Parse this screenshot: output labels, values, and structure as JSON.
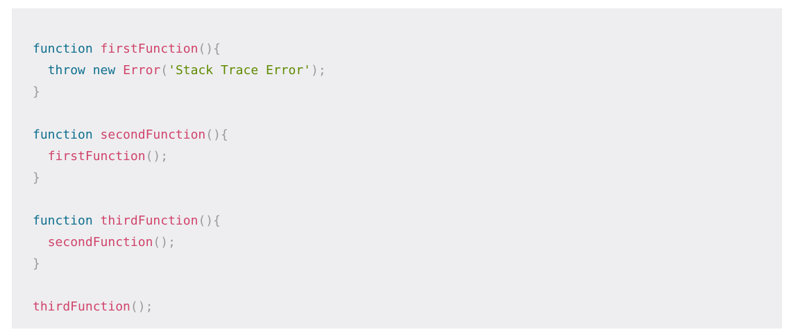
{
  "code": {
    "lines": [
      [
        {
          "t": "function",
          "c": "keyword"
        },
        {
          "t": " ",
          "c": "plain"
        },
        {
          "t": "firstFunction",
          "c": "fn"
        },
        {
          "t": "(){",
          "c": "punct"
        }
      ],
      [
        {
          "t": "  ",
          "c": "plain"
        },
        {
          "t": "throw",
          "c": "keyword"
        },
        {
          "t": " ",
          "c": "plain"
        },
        {
          "t": "new",
          "c": "keyword"
        },
        {
          "t": " ",
          "c": "plain"
        },
        {
          "t": "Error",
          "c": "fn"
        },
        {
          "t": "(",
          "c": "punct"
        },
        {
          "t": "'Stack Trace Error'",
          "c": "string"
        },
        {
          "t": ");",
          "c": "punct"
        }
      ],
      [
        {
          "t": "}",
          "c": "punct"
        }
      ],
      [],
      [
        {
          "t": "function",
          "c": "keyword"
        },
        {
          "t": " ",
          "c": "plain"
        },
        {
          "t": "secondFunction",
          "c": "fn"
        },
        {
          "t": "(){",
          "c": "punct"
        }
      ],
      [
        {
          "t": "  ",
          "c": "plain"
        },
        {
          "t": "firstFunction",
          "c": "fn"
        },
        {
          "t": "();",
          "c": "punct"
        }
      ],
      [
        {
          "t": "}",
          "c": "punct"
        }
      ],
      [],
      [
        {
          "t": "function",
          "c": "keyword"
        },
        {
          "t": " ",
          "c": "plain"
        },
        {
          "t": "thirdFunction",
          "c": "fn"
        },
        {
          "t": "(){",
          "c": "punct"
        }
      ],
      [
        {
          "t": "  ",
          "c": "plain"
        },
        {
          "t": "secondFunction",
          "c": "fn"
        },
        {
          "t": "();",
          "c": "punct"
        }
      ],
      [
        {
          "t": "}",
          "c": "punct"
        }
      ],
      [],
      [
        {
          "t": "thirdFunction",
          "c": "fn"
        },
        {
          "t": "();",
          "c": "punct"
        }
      ]
    ]
  },
  "colors": {
    "background": "#eeeef0",
    "keyword": "#0d6e8e",
    "function": "#d0436a",
    "punctuation": "#999999",
    "string": "#5f8a00"
  }
}
